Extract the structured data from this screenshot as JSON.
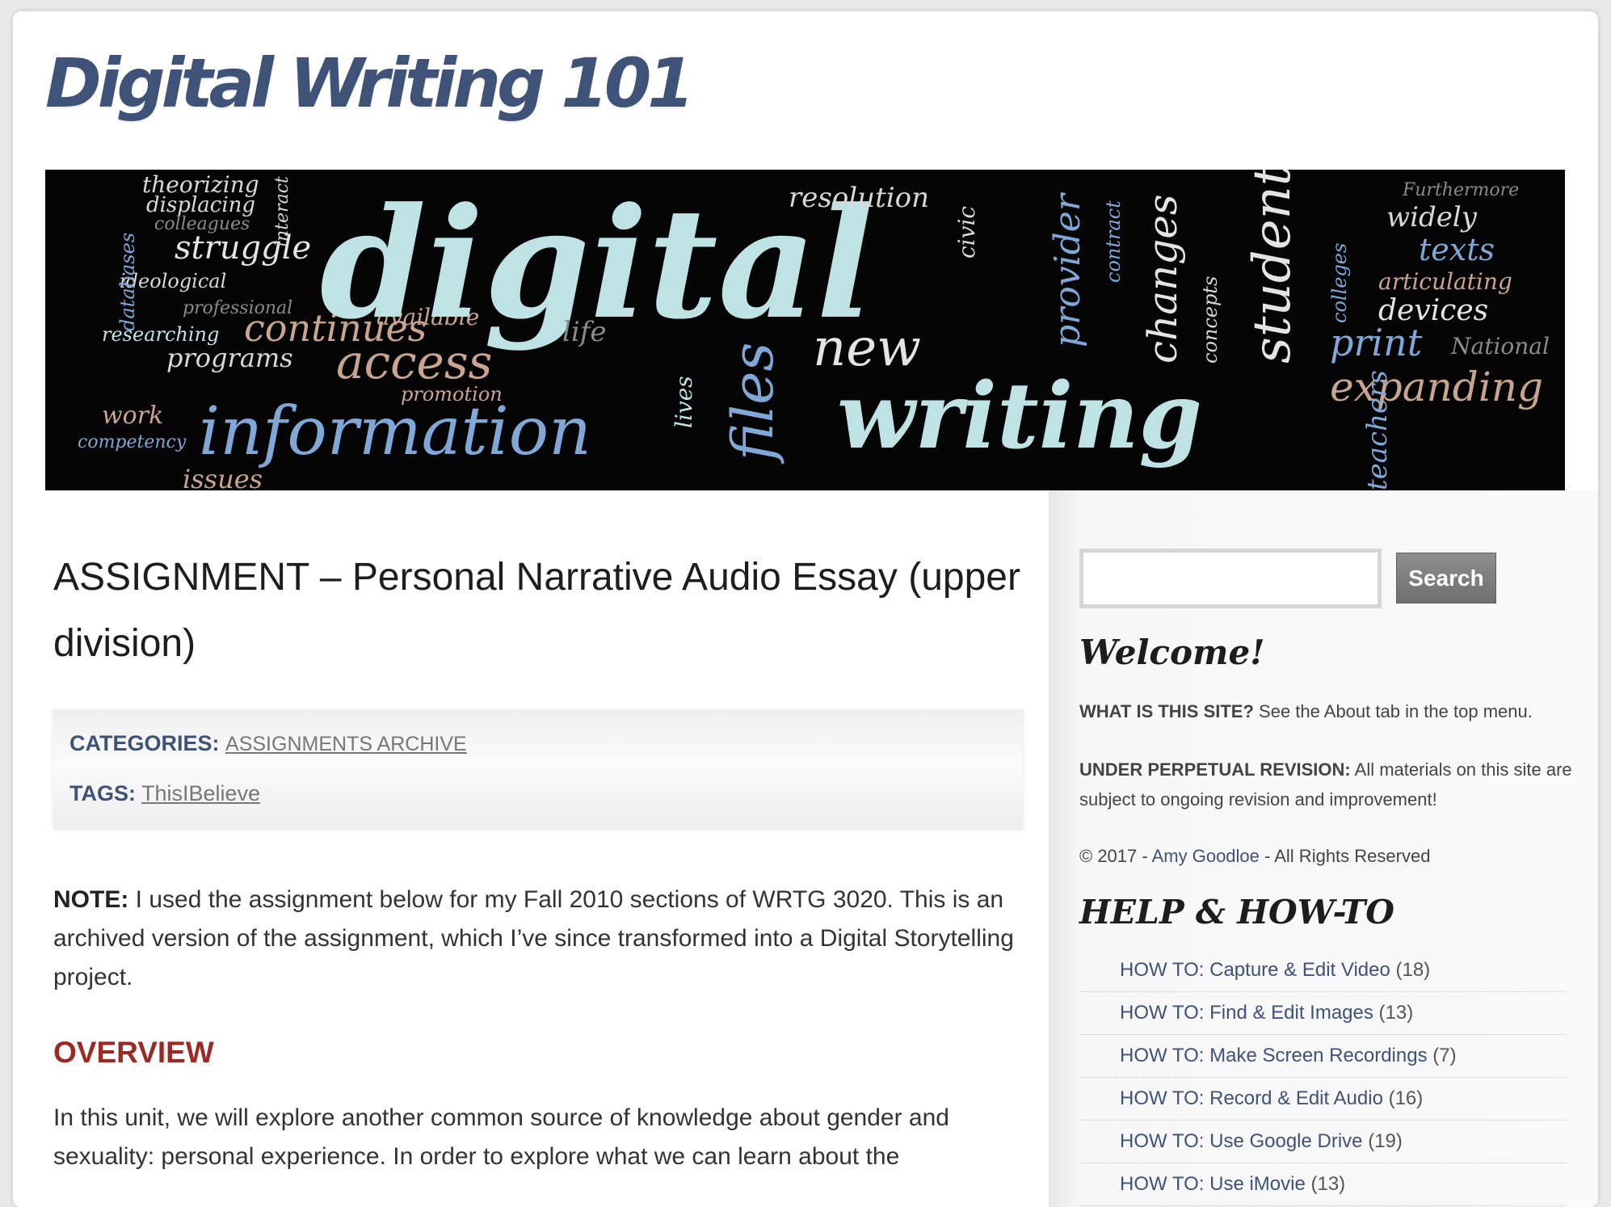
{
  "site": {
    "title": "Digital Writing 101"
  },
  "banner": {
    "words": [
      "theorizing",
      "displacing",
      "colleagues",
      "struggle",
      "ideological",
      "professional",
      "researching",
      "continues",
      "programs",
      "available",
      "access",
      "promotion",
      "work",
      "competency",
      "information",
      "issues",
      "digital",
      "writing",
      "resolution",
      "new",
      "life",
      "lives",
      "files",
      "civic",
      "provider",
      "contract",
      "changes",
      "concepts",
      "student",
      "colleges",
      "widely",
      "texts",
      "articulating",
      "devices",
      "print",
      "National",
      "expanding",
      "Furthermore",
      "teachers",
      "interact",
      "databases"
    ]
  },
  "post": {
    "title": "ASSIGNMENT – Personal Narrative Audio Essay (upper division)",
    "categories_label": "CATEGORIES:",
    "category": "Assignments Archive",
    "tags_label": "TAGS:",
    "tag": "ThisIBelieve",
    "note_label": "NOTE:",
    "note_text": " I used the assignment below for my Fall 2010 sections of WRTG 3020. This is an archived version of the assignment, which I’ve since transformed into a Digital Storytelling project.",
    "overview_heading": "OVERVIEW",
    "overview_text": "In this unit, we will explore another common source of knowledge about gender and sexuality: personal experience. In order to explore what we can learn about the"
  },
  "sidebar": {
    "search_placeholder": "",
    "search_button": "Search",
    "welcome_title": "Welcome!",
    "what_label": "WHAT IS THIS SITE?",
    "what_text": " See the About tab in the top menu.",
    "revision_label": "UNDER PERPETUAL REVISION:",
    "revision_text": " All materials on this site are subject to ongoing revision and improvement!",
    "copyright_prefix": "© 2017 - ",
    "copyright_author": "Amy Goodloe",
    "copyright_suffix": " - All Rights Reserved",
    "help_title": "HELP & HOW-TO",
    "help_items": [
      {
        "label": "HOW TO: Capture & Edit Video",
        "count": " (18)"
      },
      {
        "label": "HOW TO: Find & Edit Images",
        "count": " (13)"
      },
      {
        "label": "HOW TO: Make Screen Recordings",
        "count": " (7)"
      },
      {
        "label": "HOW TO: Record & Edit Audio",
        "count": " (16)"
      },
      {
        "label": "HOW TO: Use Google Drive",
        "count": " (19)"
      },
      {
        "label": "HOW TO: Use iMovie",
        "count": " (13)"
      }
    ]
  },
  "colors": {
    "brand": "#3f5277",
    "heading_red": "#9c2a24",
    "banner_pale": "#bfe3e4",
    "banner_blue": "#7fa8d8",
    "banner_tan": "#c9a58f"
  }
}
